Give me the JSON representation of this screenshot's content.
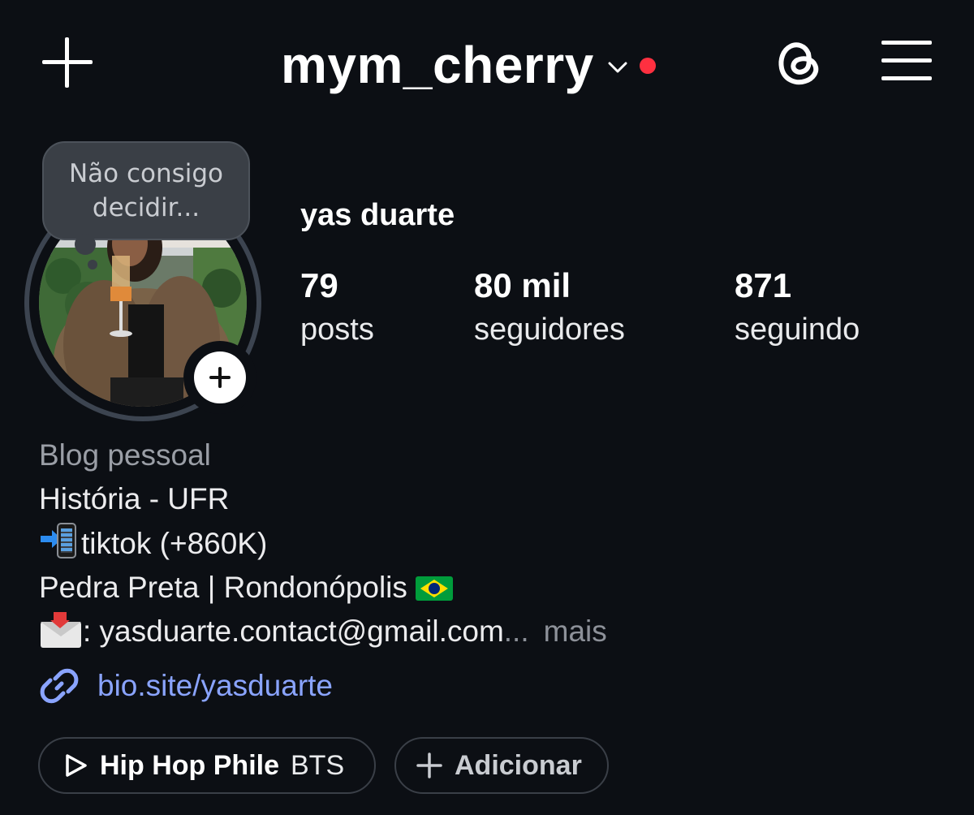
{
  "header": {
    "username": "mym_cherry"
  },
  "note": {
    "text": "Não consigo decidir..."
  },
  "profile": {
    "display_name": "yas duarte",
    "stats": [
      {
        "value": "79",
        "label": "posts"
      },
      {
        "value": "80 mil",
        "label": "seguidores"
      },
      {
        "value": "871",
        "label": "seguindo"
      }
    ]
  },
  "bio": {
    "category": "Blog pessoal",
    "line1": "História - UFR",
    "line2": "tiktok (+860K)",
    "line3": "Pedra Preta | Rondonópolis",
    "line4": ": yasduarte.contact@gmail.com",
    "ellipsis": "...",
    "more": "mais",
    "link": "bio.site/yasduarte"
  },
  "highlights": {
    "bts_bold": "Hip Hop Phile",
    "bts_light": "BTS",
    "add_label": "Adicionar"
  },
  "colors": {
    "background": "#0c0f14",
    "link": "#8aa4ff",
    "notification_dot": "#ff3040"
  }
}
